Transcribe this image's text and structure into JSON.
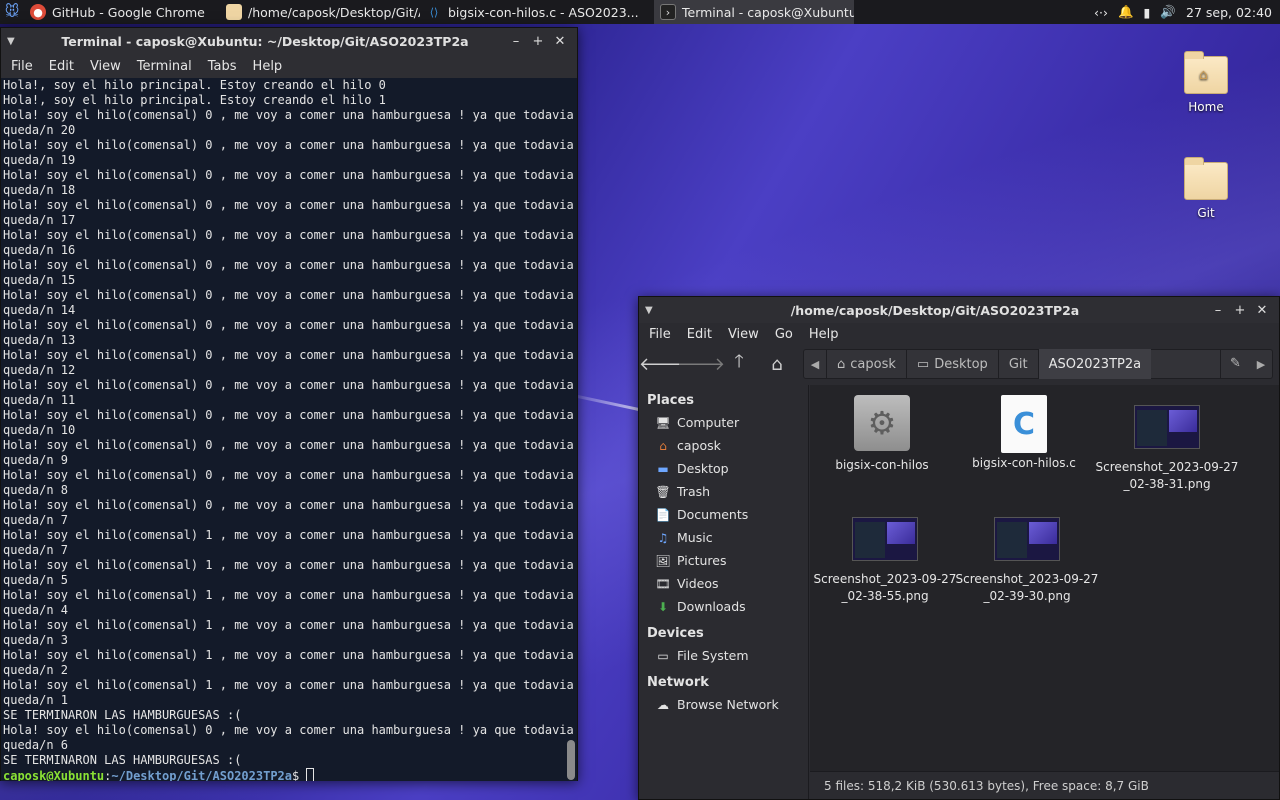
{
  "panel": {
    "tasks": [
      {
        "label": "GitHub - Google Chrome",
        "icon": "chrome-icon"
      },
      {
        "label": "/home/caposk/Desktop/Git/A...",
        "icon": "folder-icon"
      },
      {
        "label": "bigsix-con-hilos.c - ASO2023...",
        "icon": "vscode-icon"
      },
      {
        "label": "Terminal - caposk@Xubuntu: ...",
        "icon": "terminal-icon"
      }
    ],
    "clock": "27 sep, 02:40"
  },
  "desktop": {
    "icons": [
      {
        "label": "Home"
      },
      {
        "label": "Git"
      }
    ]
  },
  "terminal": {
    "title": "Terminal - caposk@Xubuntu: ~/Desktop/Git/ASO2023TP2a",
    "menu": [
      "File",
      "Edit",
      "View",
      "Terminal",
      "Tabs",
      "Help"
    ],
    "lines": [
      "Hola!, soy el hilo principal. Estoy creando el hilo 0",
      "Hola!, soy el hilo principal. Estoy creando el hilo 1",
      "Hola! soy el hilo(comensal) 0 , me voy a comer una hamburguesa ! ya que todavia",
      "queda/n 20",
      "Hola! soy el hilo(comensal) 0 , me voy a comer una hamburguesa ! ya que todavia",
      "queda/n 19",
      "Hola! soy el hilo(comensal) 0 , me voy a comer una hamburguesa ! ya que todavia",
      "queda/n 18",
      "Hola! soy el hilo(comensal) 0 , me voy a comer una hamburguesa ! ya que todavia",
      "queda/n 17",
      "Hola! soy el hilo(comensal) 0 , me voy a comer una hamburguesa ! ya que todavia",
      "queda/n 16",
      "Hola! soy el hilo(comensal) 0 , me voy a comer una hamburguesa ! ya que todavia",
      "queda/n 15",
      "Hola! soy el hilo(comensal) 0 , me voy a comer una hamburguesa ! ya que todavia",
      "queda/n 14",
      "Hola! soy el hilo(comensal) 0 , me voy a comer una hamburguesa ! ya que todavia",
      "queda/n 13",
      "Hola! soy el hilo(comensal) 0 , me voy a comer una hamburguesa ! ya que todavia",
      "queda/n 12",
      "Hola! soy el hilo(comensal) 0 , me voy a comer una hamburguesa ! ya que todavia",
      "queda/n 11",
      "Hola! soy el hilo(comensal) 0 , me voy a comer una hamburguesa ! ya que todavia",
      "queda/n 10",
      "Hola! soy el hilo(comensal) 0 , me voy a comer una hamburguesa ! ya que todavia",
      "queda/n 9",
      "Hola! soy el hilo(comensal) 0 , me voy a comer una hamburguesa ! ya que todavia",
      "queda/n 8",
      "Hola! soy el hilo(comensal) 0 , me voy a comer una hamburguesa ! ya que todavia",
      "queda/n 7",
      "Hola! soy el hilo(comensal) 1 , me voy a comer una hamburguesa ! ya que todavia",
      "queda/n 7",
      "Hola! soy el hilo(comensal) 1 , me voy a comer una hamburguesa ! ya que todavia",
      "queda/n 5",
      "Hola! soy el hilo(comensal) 1 , me voy a comer una hamburguesa ! ya que todavia",
      "queda/n 4",
      "Hola! soy el hilo(comensal) 1 , me voy a comer una hamburguesa ! ya que todavia",
      "queda/n 3",
      "Hola! soy el hilo(comensal) 1 , me voy a comer una hamburguesa ! ya que todavia",
      "queda/n 2",
      "Hola! soy el hilo(comensal) 1 , me voy a comer una hamburguesa ! ya que todavia",
      "queda/n 1",
      "SE TERMINARON LAS HAMBURGUESAS :(",
      "Hola! soy el hilo(comensal) 0 , me voy a comer una hamburguesa ! ya que todavia",
      "queda/n 6",
      "SE TERMINARON LAS HAMBURGUESAS :("
    ],
    "prompt_user": "caposk@Xubuntu",
    "prompt_sep": ":",
    "prompt_path": "~/Desktop/Git/ASO2023TP2a",
    "prompt_end": "$ "
  },
  "filemanager": {
    "title": "/home/caposk/Desktop/Git/ASO2023TP2a",
    "menu": [
      "File",
      "Edit",
      "View",
      "Go",
      "Help"
    ],
    "breadcrumbs": [
      "caposk",
      "Desktop",
      "Git",
      "ASO2023TP2a"
    ],
    "sidebar": {
      "places_title": "Places",
      "places": [
        {
          "label": "Computer",
          "icon": "computer-icon"
        },
        {
          "label": "caposk",
          "icon": "home-icon"
        },
        {
          "label": "Desktop",
          "icon": "desktop-icon"
        },
        {
          "label": "Trash",
          "icon": "trash-icon"
        },
        {
          "label": "Documents",
          "icon": "documents-icon"
        },
        {
          "label": "Music",
          "icon": "music-icon"
        },
        {
          "label": "Pictures",
          "icon": "pictures-icon"
        },
        {
          "label": "Videos",
          "icon": "videos-icon"
        },
        {
          "label": "Downloads",
          "icon": "downloads-icon"
        }
      ],
      "devices_title": "Devices",
      "devices": [
        {
          "label": "File System",
          "icon": "drive-icon"
        }
      ],
      "network_title": "Network",
      "network": [
        {
          "label": "Browse Network",
          "icon": "network-icon"
        }
      ]
    },
    "files": [
      {
        "name": "bigsix-con-hilos",
        "kind": "executable"
      },
      {
        "name": "bigsix-con-hilos.c",
        "kind": "c-source"
      },
      {
        "name": "Screenshot_2023-09-27_02-38-31.png",
        "kind": "image"
      },
      {
        "name": "Screenshot_2023-09-27_02-38-55.png",
        "kind": "image"
      },
      {
        "name": "Screenshot_2023-09-27_02-39-30.png",
        "kind": "image"
      }
    ],
    "status": "5 files: 518,2 KiB (530.613 bytes), Free space: 8,7 GiB"
  }
}
